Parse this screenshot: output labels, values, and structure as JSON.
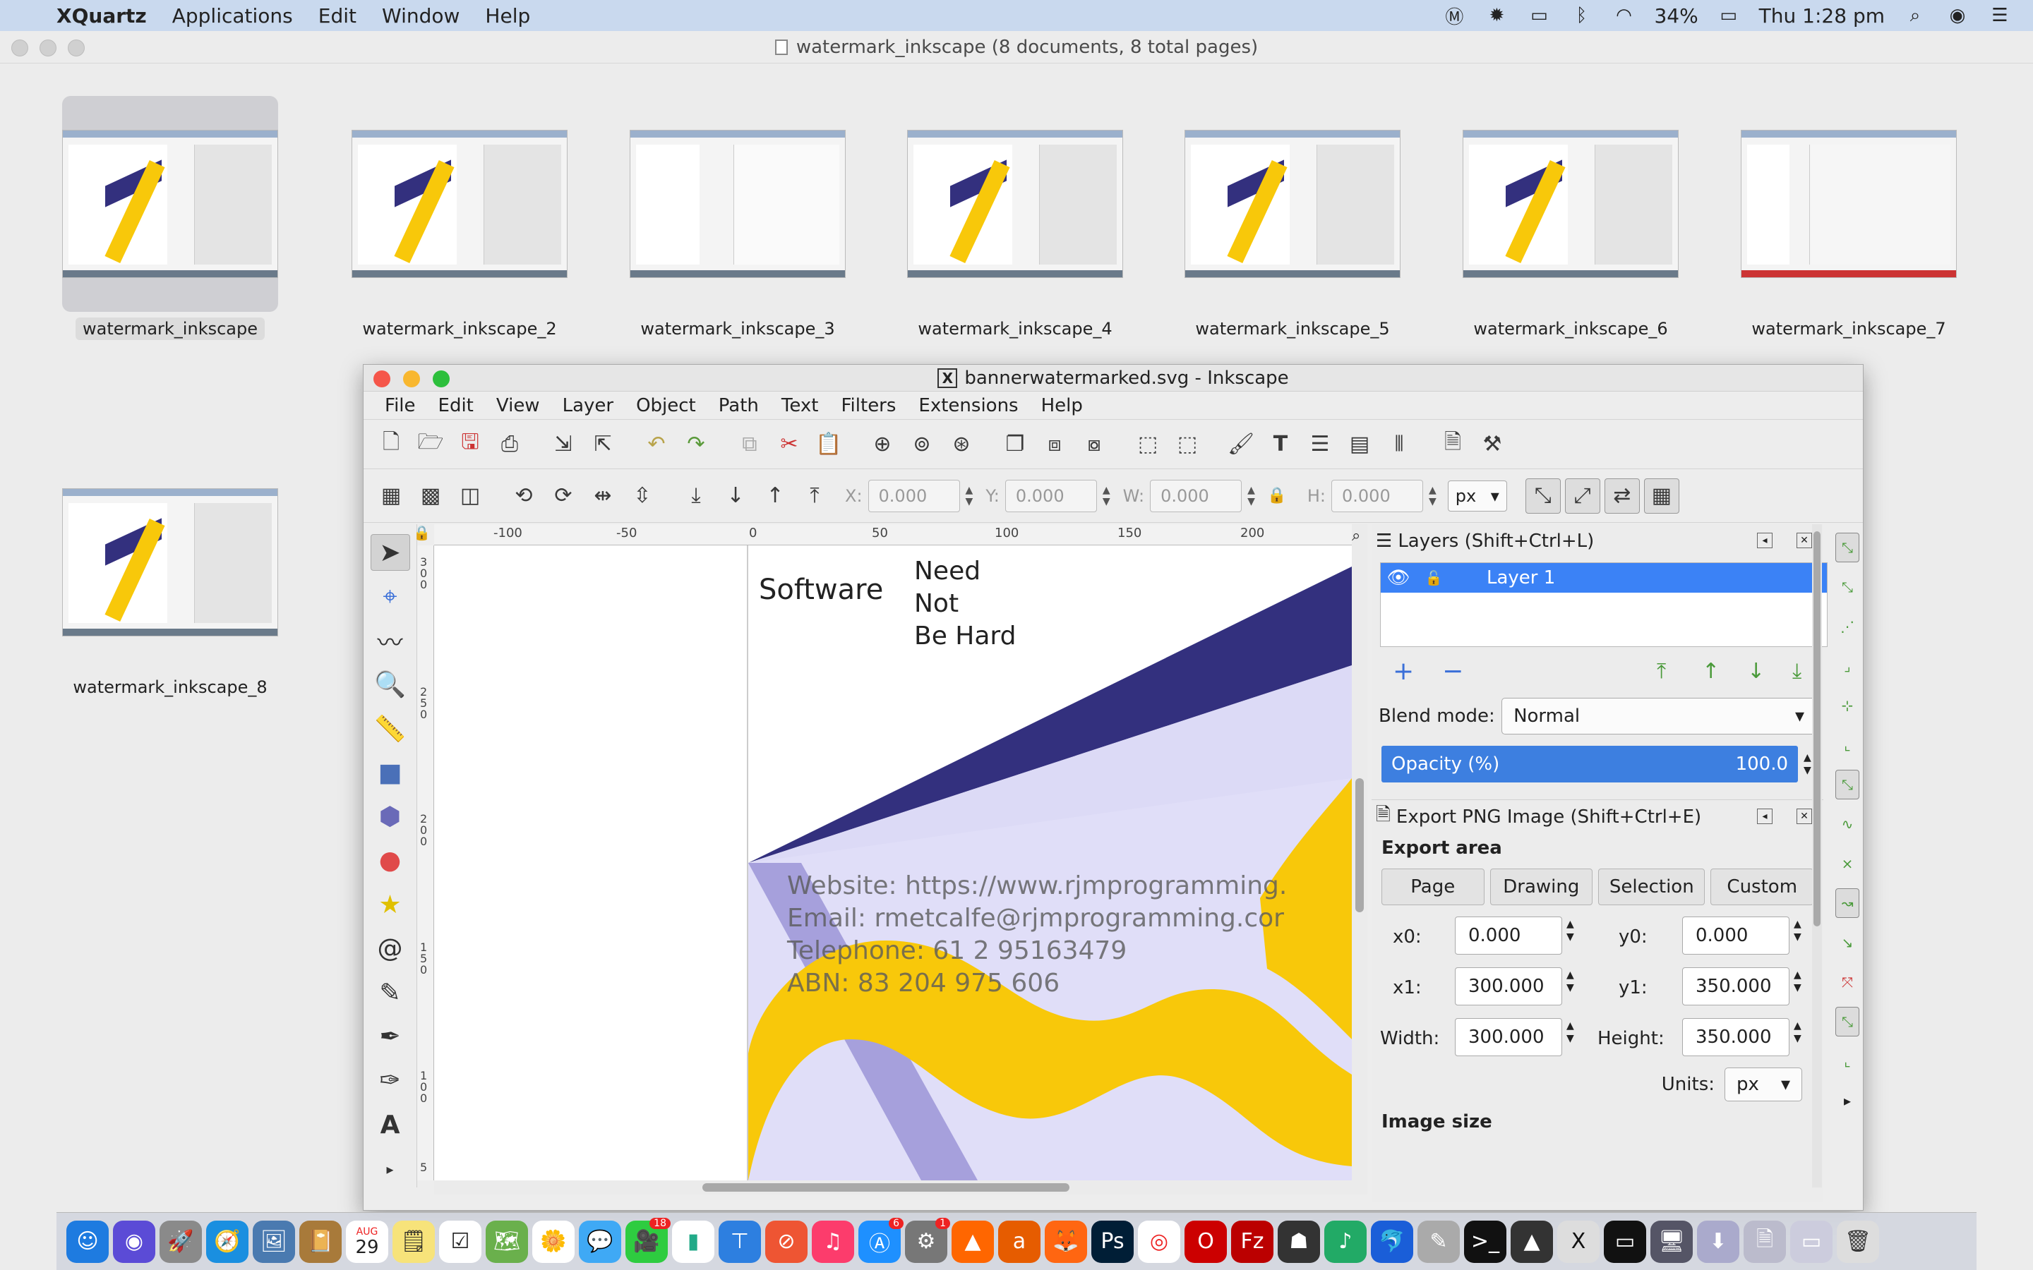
{
  "menubar": {
    "app_name": "XQuartz",
    "items": [
      "Applications",
      "Edit",
      "Window",
      "Help"
    ],
    "battery": "34%",
    "clock": "Thu 1:28 pm"
  },
  "preview": {
    "title": "watermark_inkscape (8 documents, 8 total pages)",
    "thumbnails": [
      {
        "label": "watermark_inkscape"
      },
      {
        "label": "watermark_inkscape_2"
      },
      {
        "label": "watermark_inkscape_3"
      },
      {
        "label": "watermark_inkscape_4"
      },
      {
        "label": "watermark_inkscape_5"
      },
      {
        "label": "watermark_inkscape_6"
      },
      {
        "label": "watermark_inkscape_7"
      },
      {
        "label": "watermark_inkscape_8"
      }
    ]
  },
  "inkscape": {
    "title": "bannerwatermarked.svg - Inkscape",
    "menu": [
      "File",
      "Edit",
      "View",
      "Layer",
      "Object",
      "Path",
      "Text",
      "Filters",
      "Extensions",
      "Help"
    ],
    "controls": {
      "x_label": "X:",
      "x_value": "0.000",
      "y_label": "Y:",
      "y_value": "0.000",
      "w_label": "W:",
      "w_value": "0.000",
      "h_label": "H:",
      "h_value": "0.000",
      "unit": "px"
    },
    "ruler_labels": [
      "-100",
      "-50",
      "0",
      "50",
      "100",
      "150",
      "200"
    ],
    "ruler_left_labels": [
      "3",
      "0",
      "0",
      "2",
      "5",
      "0",
      "2",
      "0",
      "0",
      "1",
      "5",
      "0",
      "1",
      "0",
      "0",
      "5"
    ],
    "canvas": {
      "software": "Software",
      "tagline": [
        "Need",
        "Not",
        "Be Hard"
      ],
      "watermark": [
        "Website: https://www.rjmprogramming.",
        "Email: rmetcalfe@rjmprogramming.cor",
        "Telephone: 61 2 95163479",
        "ABN: 83 204 975 606"
      ]
    },
    "layers_panel": {
      "title": "Layers (Shift+Ctrl+L)",
      "layer_name": "Layer 1",
      "blend_label": "Blend mode:",
      "blend_value": "Normal",
      "opacity_label": "Opacity (%)",
      "opacity_value": "100.0"
    },
    "export_panel": {
      "title": "Export PNG Image (Shift+Ctrl+E)",
      "area_label": "Export area",
      "tabs": [
        "Page",
        "Drawing",
        "Selection",
        "Custom"
      ],
      "x0_label": "x0:",
      "x0": "0.000",
      "y0_label": "y0:",
      "y0": "0.000",
      "x1_label": "x1:",
      "x1": "300.000",
      "y1_label": "y1:",
      "y1": "350.000",
      "width_label": "Width:",
      "width": "300.000",
      "height_label": "Height:",
      "height": "350.000",
      "units_label": "Units:",
      "units": "px",
      "image_size_label": "Image size"
    }
  },
  "dock": {
    "calendar_month": "AUG",
    "calendar_day": "29",
    "messages_badge": "18",
    "appstore_badge": "6",
    "prefs_badge": "1"
  },
  "colors": {
    "accent_blue": "#3b82f6",
    "banner_navy": "#33307e",
    "banner_yellow": "#f8c80a",
    "banner_lavender": "#dedcf7"
  }
}
